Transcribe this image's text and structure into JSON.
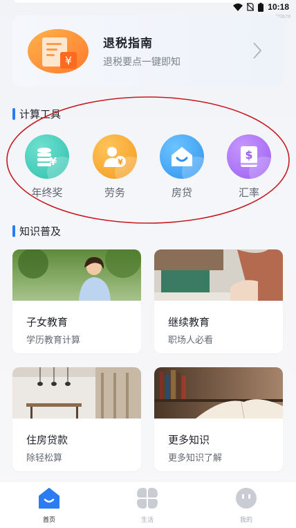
{
  "status_bar": {
    "time": "10:18",
    "build_tag": "f30b78",
    "icons": [
      "wifi-icon",
      "no-sim-icon",
      "battery-icon"
    ]
  },
  "banner": {
    "title": "退税指南",
    "subtitle": "退税要点一键即知",
    "icon": "refund-receipt-icon",
    "currency_symbol": "¥"
  },
  "tools_section": {
    "title": "计算工具",
    "items": [
      {
        "label": "年终奖",
        "icon": "coin-stack-icon",
        "color": "#3ec9b8"
      },
      {
        "label": "劳务",
        "icon": "person-yuan-icon",
        "color": "#f5a52c"
      },
      {
        "label": "房贷",
        "icon": "house-smile-icon",
        "color": "#3aa3f2"
      },
      {
        "label": "汇率",
        "icon": "dollar-book-icon",
        "color": "#a66bf0"
      }
    ]
  },
  "knowledge_section": {
    "title": "知识普及",
    "cards": [
      {
        "title": "子女教育",
        "subtitle": "学历教育计算",
        "image": "child-running-photo"
      },
      {
        "title": "继续教育",
        "subtitle": "职场人必看",
        "image": "person-writing-photo"
      },
      {
        "title": "住房贷款",
        "subtitle": "除轻松算",
        "image": "dining-room-photo"
      },
      {
        "title": "更多知识",
        "subtitle": "更多知识了解",
        "image": "open-book-photo"
      }
    ]
  },
  "tabbar": {
    "items": [
      {
        "label": "首页",
        "icon": "home-smile-icon",
        "active": true
      },
      {
        "label": "生活",
        "icon": "four-leaf-icon",
        "active": false
      },
      {
        "label": "我的",
        "icon": "face-icon",
        "active": false
      }
    ],
    "accent_color": "#2b7bf3",
    "inactive_color": "#c9ccd3"
  }
}
